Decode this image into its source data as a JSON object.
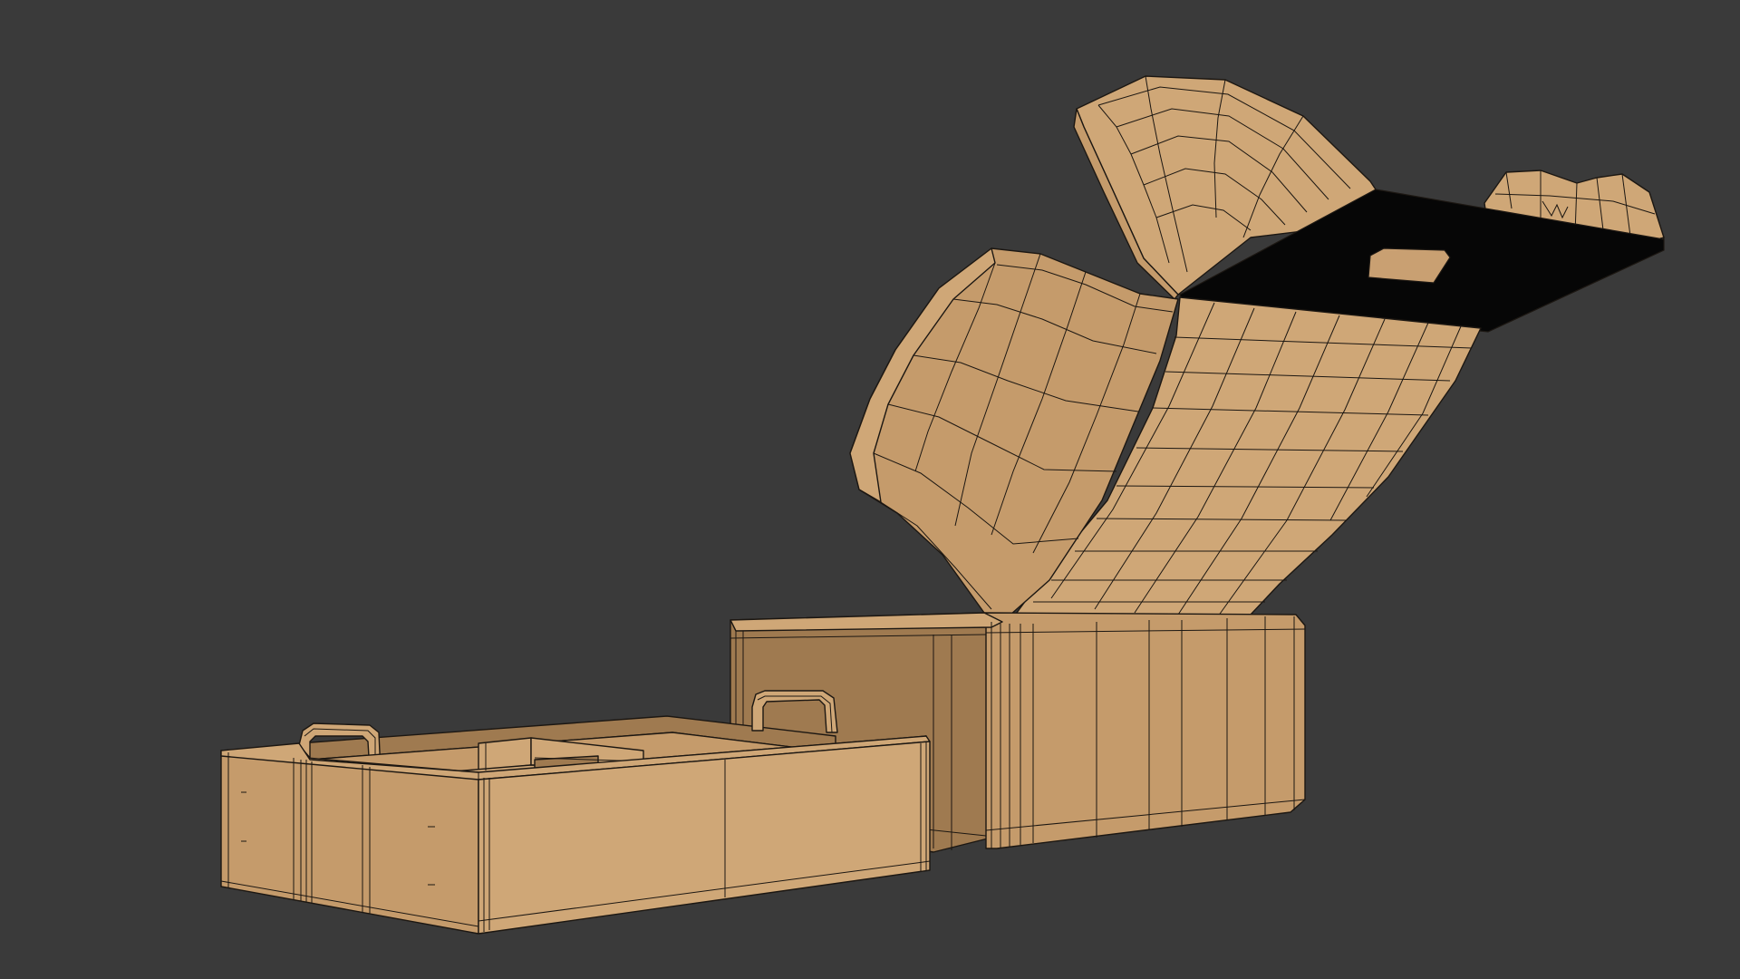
{
  "viewport": {
    "background": "#3a3a3a"
  },
  "colors": {
    "cardboard": "#c59b6b",
    "cardboard_light": "#cfa777",
    "cardboard_dark": "#9f7a50",
    "cardboard_shadow": "#7e5f3c",
    "wire": "#1c1712",
    "black_panel": "#060606",
    "window_slot": "#c9a072"
  },
  "models": [
    {
      "name": "open-lid-box",
      "parts": [
        "box-body",
        "lid-back-panel",
        "lid-flap",
        "lid-top-flap",
        "tab-flap",
        "black-inner-panel",
        "window-slot"
      ]
    },
    {
      "name": "tray-with-handles",
      "parts": [
        "tray-body",
        "tray-dividers",
        "left-handle",
        "right-handle"
      ]
    }
  ]
}
